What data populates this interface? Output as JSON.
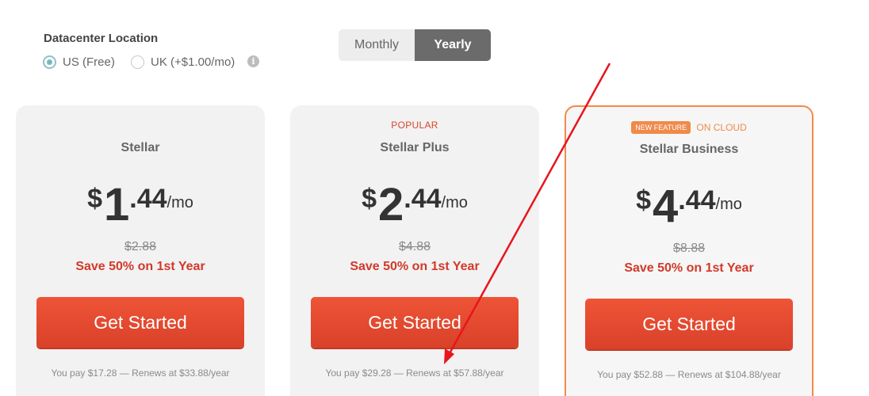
{
  "datacenter": {
    "title": "Datacenter Location",
    "options": [
      {
        "label": "US (Free)",
        "checked": true
      },
      {
        "label": "UK (+$1.00/mo)",
        "checked": false
      }
    ],
    "info_icon": "i"
  },
  "billing_toggle": {
    "options": [
      "Monthly",
      "Yearly"
    ],
    "selected": "Yearly"
  },
  "plans": [
    {
      "badge": "",
      "name": "Stellar",
      "currency": "$",
      "whole": "1",
      "cents": ".44",
      "per": "/mo",
      "old_price": "$2.88",
      "save": "Save 50% on 1st Year",
      "cta": "Get Started",
      "renew": "You pay $17.28 — Renews at $33.88/year"
    },
    {
      "badge": "POPULAR",
      "name": "Stellar Plus",
      "currency": "$",
      "whole": "2",
      "cents": ".44",
      "per": "/mo",
      "old_price": "$4.88",
      "save": "Save 50% on 1st Year",
      "cta": "Get Started",
      "renew": "You pay $29.28 — Renews at $57.88/year"
    },
    {
      "badge_new": "NEW FEATURE",
      "badge": "ON CLOUD",
      "name": "Stellar Business",
      "currency": "$",
      "whole": "4",
      "cents": ".44",
      "per": "/mo",
      "old_price": "$8.88",
      "save": "Save 50% on 1st Year",
      "cta": "Get Started",
      "renew": "You pay $52.88 — Renews at $104.88/year"
    }
  ],
  "colors": {
    "accent": "#e64a2e",
    "highlight_border": "#f28a4a",
    "annotation_arrow": "#e8151b"
  },
  "annotation": {
    "icon": "red-arrow-annotation"
  }
}
